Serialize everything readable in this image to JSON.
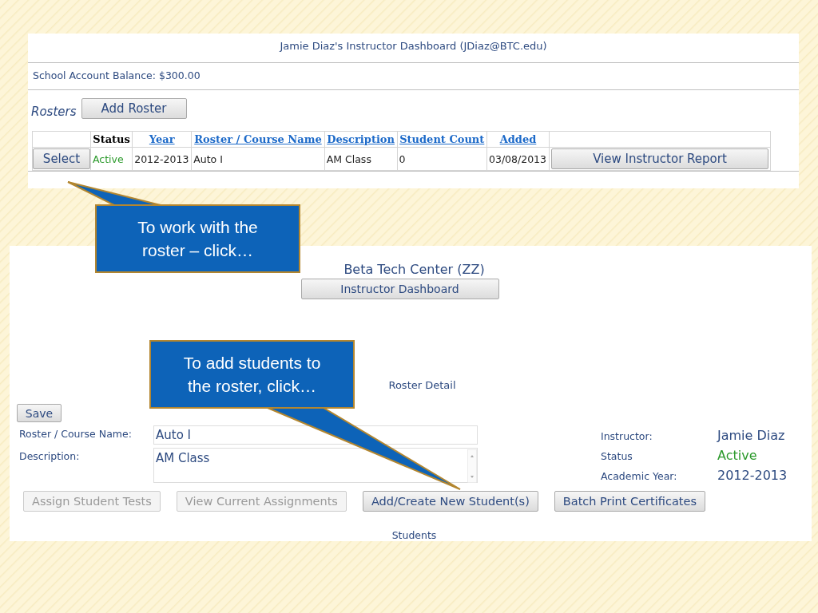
{
  "top_panel": {
    "title": "Jamie Diaz's Instructor Dashboard (JDiaz@BTC.edu)",
    "balance": "School Account Balance: $300.00",
    "rosters_label": "Rosters",
    "add_button": "Add Roster",
    "table": {
      "columns": [
        {
          "label": "Status",
          "link": false
        },
        {
          "label": "Year",
          "link": true
        },
        {
          "label": "Roster / Course Name",
          "link": true
        },
        {
          "label": "Description",
          "link": true
        },
        {
          "label": "Student Count",
          "link": true
        },
        {
          "label": "Added",
          "link": true
        }
      ],
      "rows": [
        {
          "select": "Select",
          "status": "Active",
          "year": "2012-2013",
          "name": "Auto I",
          "description": "AM Class",
          "count": "0",
          "added": "03/08/2013",
          "report": "View Instructor Report"
        }
      ]
    }
  },
  "bottom_panel": {
    "center": "Beta Tech Center (ZZ)",
    "dashboard_button": "Instructor Dashboard",
    "section_title": "Roster Detail",
    "save": "Save",
    "fields": [
      {
        "label": "Roster / Course Name:",
        "value": "Auto I",
        "kind": "input"
      },
      {
        "label": "Description:",
        "value": "AM Class",
        "kind": "textarea"
      }
    ],
    "info": [
      {
        "label": "Instructor:",
        "value": "Jamie Diaz",
        "kind": "text"
      },
      {
        "label": "Status",
        "value": "Active",
        "kind": "status"
      },
      {
        "label": "Academic Year:",
        "value": "2012-2013",
        "kind": "text"
      }
    ],
    "buttons": [
      {
        "label": "Assign Student Tests",
        "disabled": true
      },
      {
        "label": "View Current Assignments",
        "disabled": true
      },
      {
        "label": "Add/Create New Student(s)",
        "disabled": false
      },
      {
        "label": "Batch Print Certificates",
        "disabled": false
      }
    ],
    "students_heading": "Students"
  },
  "callouts": [
    {
      "text": "To work with the roster – click…"
    },
    {
      "text": "To add students to the roster, click…"
    }
  ]
}
